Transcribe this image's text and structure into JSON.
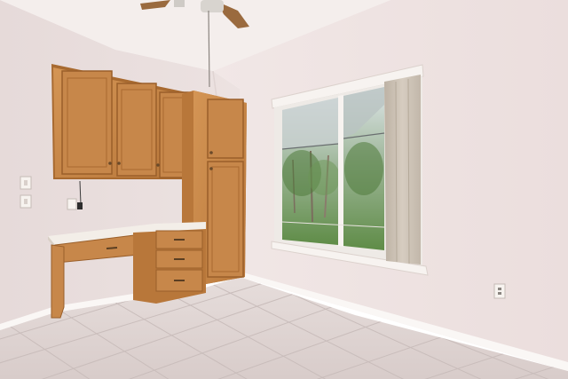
{
  "scene": {
    "kind": "photograph",
    "subject": "empty-room-interior",
    "colors": {
      "wall_left": "#ece2e1",
      "wall_right": "#f1e7e6",
      "ceiling": "#f4eeec",
      "floor": "#ddd3d1",
      "grout": "#c9bdbb",
      "baseboard": "#faf7f5",
      "wood": "#c98a4a",
      "wood_dark": "#a86a30",
      "countertop": "#f3eee8",
      "window_frame": "#f7f3f0",
      "glass_green": "#6e9a55",
      "sky": "#dfe6ea",
      "curtain": "#cfc5b8",
      "fan": "#9a6a3e"
    },
    "icons": [
      "ceiling-fan-icon",
      "light-switch-icon",
      "power-outlet-icon"
    ]
  }
}
